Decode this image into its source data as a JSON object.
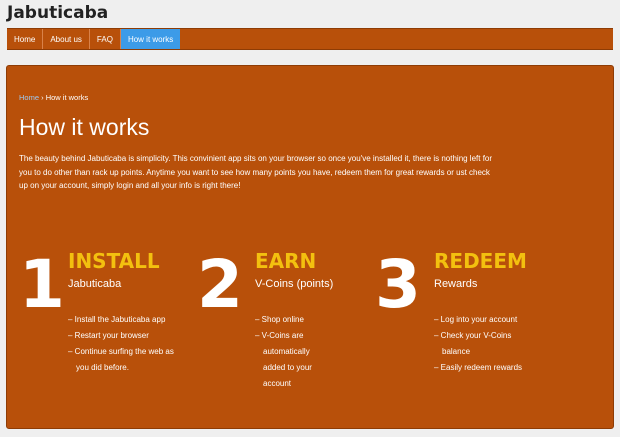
{
  "site": {
    "title": "Jabuticaba"
  },
  "nav": [
    {
      "label": "Home"
    },
    {
      "label": "About us"
    },
    {
      "label": "FAQ"
    },
    {
      "label": "How it works",
      "active": true
    }
  ],
  "breadcrumb": {
    "home": "Home",
    "separator": "›",
    "current": "How it works"
  },
  "page": {
    "title": "How it works",
    "intro": "The beauty behind Jabuticaba is simplicity. This convinient app sits on your browser so once you've installed it, there is nothing left for you to do other than rack up points. Anytime you want to see how many points you have, redeem them for great rewards or ust check up on your account, simply login and all your info is right there!"
  },
  "steps": [
    {
      "number": "1",
      "title": "INSTALL",
      "subtitle": "Jabuticaba",
      "items": [
        "– Install the Jabuticaba app",
        "– Restart your browser",
        "– Continue surfing the web as you did before."
      ]
    },
    {
      "number": "2",
      "title": "EARN",
      "subtitle": "V-Coins (points)",
      "items": [
        "– Shop online",
        "– V-Coins are automatically added to your account"
      ]
    },
    {
      "number": "3",
      "title": "REDEEM",
      "subtitle": "Rewards",
      "items": [
        "– Log into your account",
        "– Check your V-Coins balance",
        "– Easily redeem rewards"
      ]
    }
  ],
  "colors": {
    "brand_orange": "#b8500a",
    "nav_active": "#3c9be8",
    "accent_yellow": "#f3c00f",
    "link_blue": "#9ec9f0"
  }
}
